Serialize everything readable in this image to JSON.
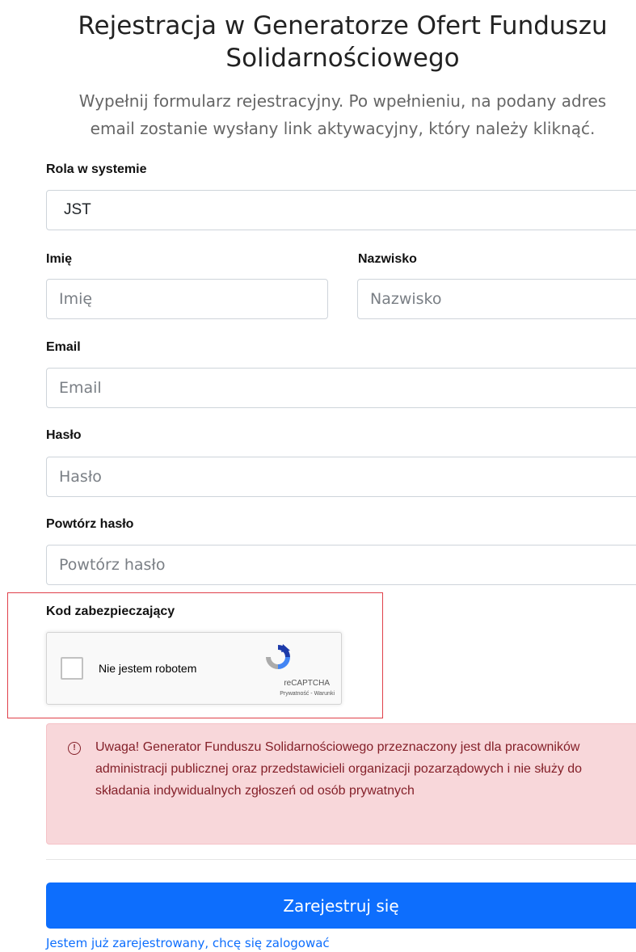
{
  "header": {
    "title_line1": "Rejestracja w Generatorze Ofert Funduszu",
    "title_line2": "Solidarnościowego",
    "subtitle_line1": "Wypełnij formularz rejestracyjny. Po wpełnieniu, na podany adres",
    "subtitle_line2": "email zostanie wysłany link aktywacyjny, który należy kliknąć."
  },
  "form": {
    "role": {
      "label": "Rola w systemie",
      "value": "JST"
    },
    "first_name": {
      "label": "Imię",
      "placeholder": "Imię"
    },
    "last_name": {
      "label": "Nazwisko",
      "placeholder": "Nazwisko"
    },
    "email": {
      "label": "Email",
      "placeholder": "Email"
    },
    "password": {
      "label": "Hasło",
      "placeholder": "Hasło"
    },
    "password_repeat": {
      "label": "Powtórz hasło",
      "placeholder": "Powtórz hasło"
    },
    "security": {
      "label": "Kod zabezpieczający",
      "captcha_text": "Nie jestem robotem",
      "captcha_brand": "reCAPTCHA",
      "captcha_links": "Prywatność - Warunki"
    }
  },
  "alert": {
    "icon": "!",
    "text": "Uwaga! Generator Funduszu Solidarnościowego przeznaczony jest dla pracowników administracji publicznej oraz przedstawicieli organizacji pozarządowych i nie służy do składania indywidualnych zgłoszeń od osób prywatnych"
  },
  "actions": {
    "submit_label": "Zarejestruj się",
    "login_link": "Jestem już zarejestrowany, chcę się zalogować"
  },
  "colors": {
    "primary": "#0d6efd",
    "alert_bg": "#f8d7da",
    "alert_text": "#842029",
    "highlight_border": "#e0404a"
  }
}
